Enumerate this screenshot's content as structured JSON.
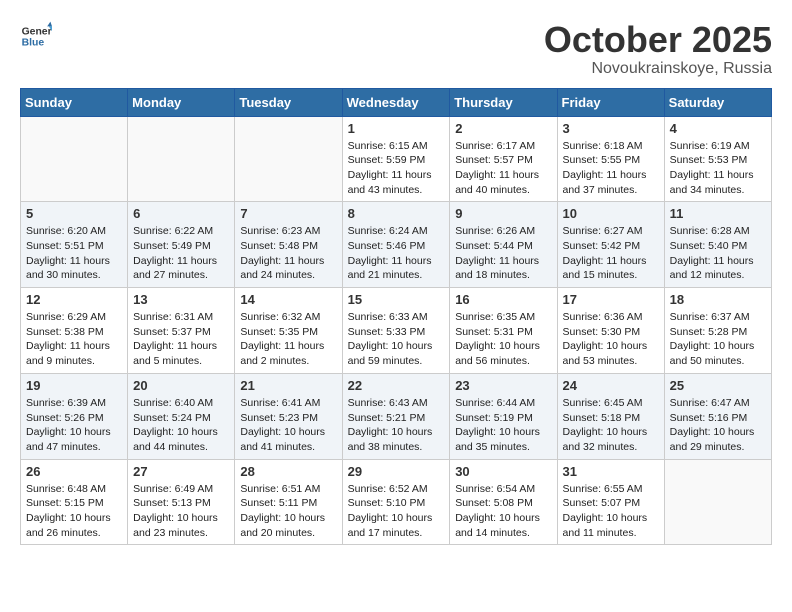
{
  "logo": {
    "general": "General",
    "blue": "Blue"
  },
  "title": "October 2025",
  "location": "Novoukrainskoye, Russia",
  "weekdays": [
    "Sunday",
    "Monday",
    "Tuesday",
    "Wednesday",
    "Thursday",
    "Friday",
    "Saturday"
  ],
  "weeks": [
    [
      {
        "day": "",
        "info": ""
      },
      {
        "day": "",
        "info": ""
      },
      {
        "day": "",
        "info": ""
      },
      {
        "day": "1",
        "info": "Sunrise: 6:15 AM\nSunset: 5:59 PM\nDaylight: 11 hours\nand 43 minutes."
      },
      {
        "day": "2",
        "info": "Sunrise: 6:17 AM\nSunset: 5:57 PM\nDaylight: 11 hours\nand 40 minutes."
      },
      {
        "day": "3",
        "info": "Sunrise: 6:18 AM\nSunset: 5:55 PM\nDaylight: 11 hours\nand 37 minutes."
      },
      {
        "day": "4",
        "info": "Sunrise: 6:19 AM\nSunset: 5:53 PM\nDaylight: 11 hours\nand 34 minutes."
      }
    ],
    [
      {
        "day": "5",
        "info": "Sunrise: 6:20 AM\nSunset: 5:51 PM\nDaylight: 11 hours\nand 30 minutes."
      },
      {
        "day": "6",
        "info": "Sunrise: 6:22 AM\nSunset: 5:49 PM\nDaylight: 11 hours\nand 27 minutes."
      },
      {
        "day": "7",
        "info": "Sunrise: 6:23 AM\nSunset: 5:48 PM\nDaylight: 11 hours\nand 24 minutes."
      },
      {
        "day": "8",
        "info": "Sunrise: 6:24 AM\nSunset: 5:46 PM\nDaylight: 11 hours\nand 21 minutes."
      },
      {
        "day": "9",
        "info": "Sunrise: 6:26 AM\nSunset: 5:44 PM\nDaylight: 11 hours\nand 18 minutes."
      },
      {
        "day": "10",
        "info": "Sunrise: 6:27 AM\nSunset: 5:42 PM\nDaylight: 11 hours\nand 15 minutes."
      },
      {
        "day": "11",
        "info": "Sunrise: 6:28 AM\nSunset: 5:40 PM\nDaylight: 11 hours\nand 12 minutes."
      }
    ],
    [
      {
        "day": "12",
        "info": "Sunrise: 6:29 AM\nSunset: 5:38 PM\nDaylight: 11 hours\nand 9 minutes."
      },
      {
        "day": "13",
        "info": "Sunrise: 6:31 AM\nSunset: 5:37 PM\nDaylight: 11 hours\nand 5 minutes."
      },
      {
        "day": "14",
        "info": "Sunrise: 6:32 AM\nSunset: 5:35 PM\nDaylight: 11 hours\nand 2 minutes."
      },
      {
        "day": "15",
        "info": "Sunrise: 6:33 AM\nSunset: 5:33 PM\nDaylight: 10 hours\nand 59 minutes."
      },
      {
        "day": "16",
        "info": "Sunrise: 6:35 AM\nSunset: 5:31 PM\nDaylight: 10 hours\nand 56 minutes."
      },
      {
        "day": "17",
        "info": "Sunrise: 6:36 AM\nSunset: 5:30 PM\nDaylight: 10 hours\nand 53 minutes."
      },
      {
        "day": "18",
        "info": "Sunrise: 6:37 AM\nSunset: 5:28 PM\nDaylight: 10 hours\nand 50 minutes."
      }
    ],
    [
      {
        "day": "19",
        "info": "Sunrise: 6:39 AM\nSunset: 5:26 PM\nDaylight: 10 hours\nand 47 minutes."
      },
      {
        "day": "20",
        "info": "Sunrise: 6:40 AM\nSunset: 5:24 PM\nDaylight: 10 hours\nand 44 minutes."
      },
      {
        "day": "21",
        "info": "Sunrise: 6:41 AM\nSunset: 5:23 PM\nDaylight: 10 hours\nand 41 minutes."
      },
      {
        "day": "22",
        "info": "Sunrise: 6:43 AM\nSunset: 5:21 PM\nDaylight: 10 hours\nand 38 minutes."
      },
      {
        "day": "23",
        "info": "Sunrise: 6:44 AM\nSunset: 5:19 PM\nDaylight: 10 hours\nand 35 minutes."
      },
      {
        "day": "24",
        "info": "Sunrise: 6:45 AM\nSunset: 5:18 PM\nDaylight: 10 hours\nand 32 minutes."
      },
      {
        "day": "25",
        "info": "Sunrise: 6:47 AM\nSunset: 5:16 PM\nDaylight: 10 hours\nand 29 minutes."
      }
    ],
    [
      {
        "day": "26",
        "info": "Sunrise: 6:48 AM\nSunset: 5:15 PM\nDaylight: 10 hours\nand 26 minutes."
      },
      {
        "day": "27",
        "info": "Sunrise: 6:49 AM\nSunset: 5:13 PM\nDaylight: 10 hours\nand 23 minutes."
      },
      {
        "day": "28",
        "info": "Sunrise: 6:51 AM\nSunset: 5:11 PM\nDaylight: 10 hours\nand 20 minutes."
      },
      {
        "day": "29",
        "info": "Sunrise: 6:52 AM\nSunset: 5:10 PM\nDaylight: 10 hours\nand 17 minutes."
      },
      {
        "day": "30",
        "info": "Sunrise: 6:54 AM\nSunset: 5:08 PM\nDaylight: 10 hours\nand 14 minutes."
      },
      {
        "day": "31",
        "info": "Sunrise: 6:55 AM\nSunset: 5:07 PM\nDaylight: 10 hours\nand 11 minutes."
      },
      {
        "day": "",
        "info": ""
      }
    ]
  ]
}
